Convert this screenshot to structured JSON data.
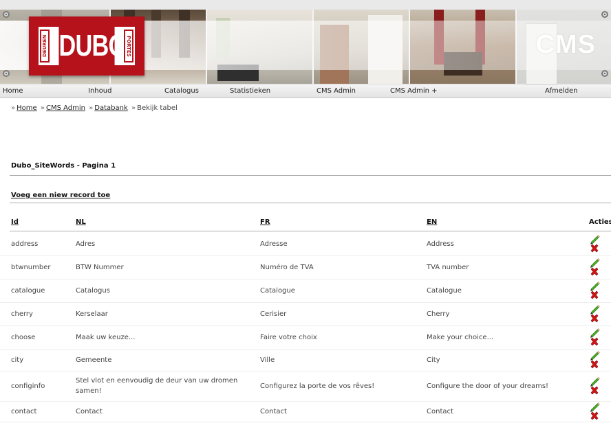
{
  "header": {
    "logo": {
      "text": "DUBO",
      "left_text": "DEUREN",
      "right_text": "PORTES"
    },
    "title": "CMS"
  },
  "nav": {
    "items": [
      {
        "label": "Home"
      },
      {
        "label": "Inhoud"
      },
      {
        "label": "Catalogus"
      },
      {
        "label": "Statistieken"
      },
      {
        "label": "CMS Admin"
      },
      {
        "label": "CMS Admin +"
      },
      {
        "label": "Afmelden"
      }
    ]
  },
  "breadcrumb": {
    "items": [
      {
        "label": "Home"
      },
      {
        "label": "CMS Admin"
      },
      {
        "label": "Databank"
      }
    ],
    "current": "Bekijk tabel"
  },
  "page": {
    "title": "Dubo_SiteWords - Pagina 1",
    "add_record": "Voeg een niew record toe"
  },
  "table": {
    "columns": [
      "Id",
      "NL",
      "FR",
      "EN",
      "Acties"
    ],
    "rows": [
      {
        "id": "address",
        "nl": "Adres",
        "fr": "Adresse",
        "en": "Address"
      },
      {
        "id": "btwnumber",
        "nl": "BTW Nummer",
        "fr": "Numéro de TVA",
        "en": "TVA number"
      },
      {
        "id": "catalogue",
        "nl": "Catalogus",
        "fr": "Catalogue",
        "en": "Catalogue"
      },
      {
        "id": "cherry",
        "nl": "Kerselaar",
        "fr": "Cerisier",
        "en": "Cherry"
      },
      {
        "id": "choose",
        "nl": "Maak uw keuze...",
        "fr": "Faire votre choix",
        "en": "Make your choice..."
      },
      {
        "id": "city",
        "nl": "Gemeente",
        "fr": "Ville",
        "en": "City"
      },
      {
        "id": "configinfo",
        "nl": "Stel vlot en eenvoudig de deur van uw dromen samen!",
        "fr": "Configurez la porte de vos rêves!",
        "en": "Configure the door of your dreams!"
      },
      {
        "id": "contact",
        "nl": "Contact",
        "fr": "Contact",
        "en": "Contact"
      }
    ],
    "icons": {
      "edit": "pencil-icon",
      "delete": "delete-x-icon"
    }
  },
  "colors": {
    "brand_red": "#b5121b",
    "nav_bg": "#e9e9e9",
    "edit_green": "#3f9a1c",
    "delete_red": "#cc1111"
  }
}
